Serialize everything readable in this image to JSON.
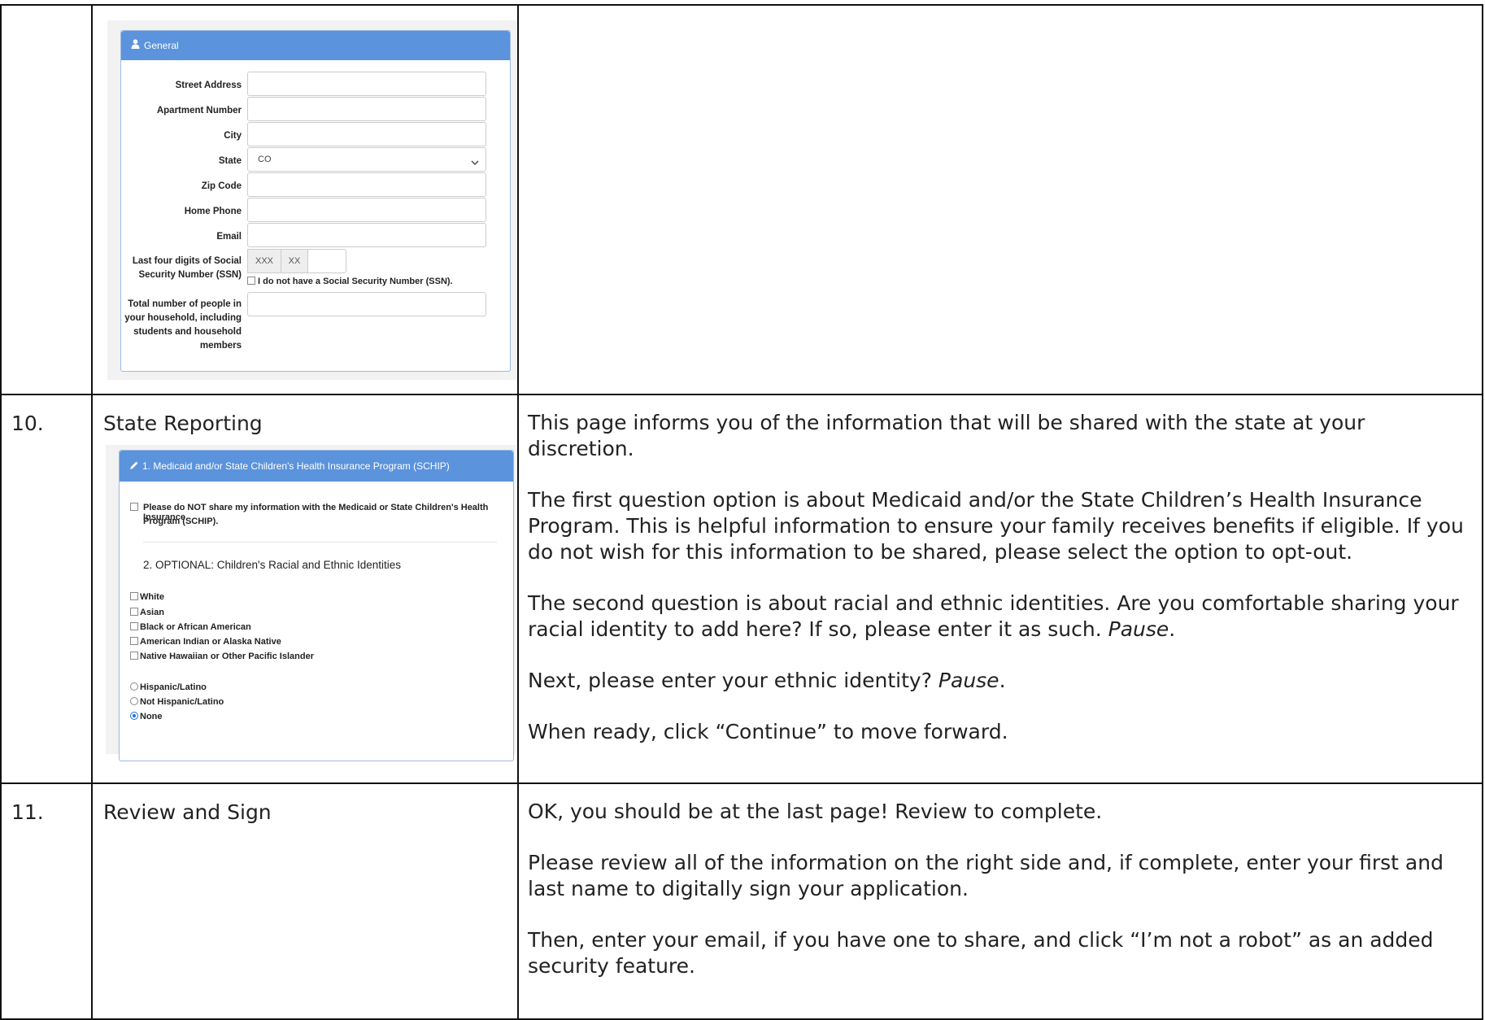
{
  "general_form": {
    "header": "General",
    "fields": [
      {
        "label": "Street Address"
      },
      {
        "label": "Apartment Number"
      },
      {
        "label": "City"
      },
      {
        "label": "State",
        "value": "CO"
      },
      {
        "label": "Zip Code"
      },
      {
        "label": "Home Phone"
      },
      {
        "label": "Email"
      }
    ],
    "ssn_label_1": "Last four digits of Social",
    "ssn_label_2": "Security Number (SSN)",
    "ssn_prefix_1": "XXX",
    "ssn_prefix_2": "XX",
    "no_ssn_label": "I do not have a Social Security Number (SSN).",
    "household_label": [
      "Total number of people in",
      "your household, including",
      "students and household",
      "members"
    ]
  },
  "rows": [
    {
      "number": "10.",
      "title": "State Reporting",
      "paragraphs": [
        "This page informs you of the information that will be shared with the state at your discretion.",
        "The first question option is about Medicaid and/or the State Children’s Health Insurance Program. This is helpful information to ensure your family receives benefits if eligible. If you do not wish for this information to be shared, please select the option to opt-out.",
        "The second question is about racial and ethnic identities. Are you comfortable sharing your racial identity to add here? If so, please enter it as such.",
        "Next, please enter your ethnic identity?",
        "When ready, click “Continue” to move forward."
      ],
      "pause": "Pause",
      "pause_suffix": "."
    },
    {
      "number": "11.",
      "title": "Review and Sign",
      "paragraphs": [
        "OK, you should be at the last page! Review to complete.",
        "Please review all of the information on the right side and, if complete, enter your first and last name to digitally sign your application.",
        "Then, enter your email, if you have one to share, and click “I’m not a robot” as an added security feature."
      ]
    }
  ],
  "state_form": {
    "header": "1. Medicaid and/or State Children's Health Insurance Program (SCHIP)",
    "optout_1": "Please do NOT share my information with the Medicaid or State Children's Health Insurance",
    "optout_2": "Program (SCHIP).",
    "section2": "2. OPTIONAL: Children's Racial and Ethnic Identities",
    "races": [
      "White",
      "Asian",
      "Black or African American",
      "American Indian or Alaska Native",
      "Native Hawaiian or Other Pacific Islander"
    ],
    "ethnicities": [
      "Hispanic/Latino",
      "Not Hispanic/Latino",
      "None"
    ],
    "selected_ethnicity": "None"
  },
  "colors": {
    "panel_header": "#5b93dc",
    "border": "#111111"
  }
}
